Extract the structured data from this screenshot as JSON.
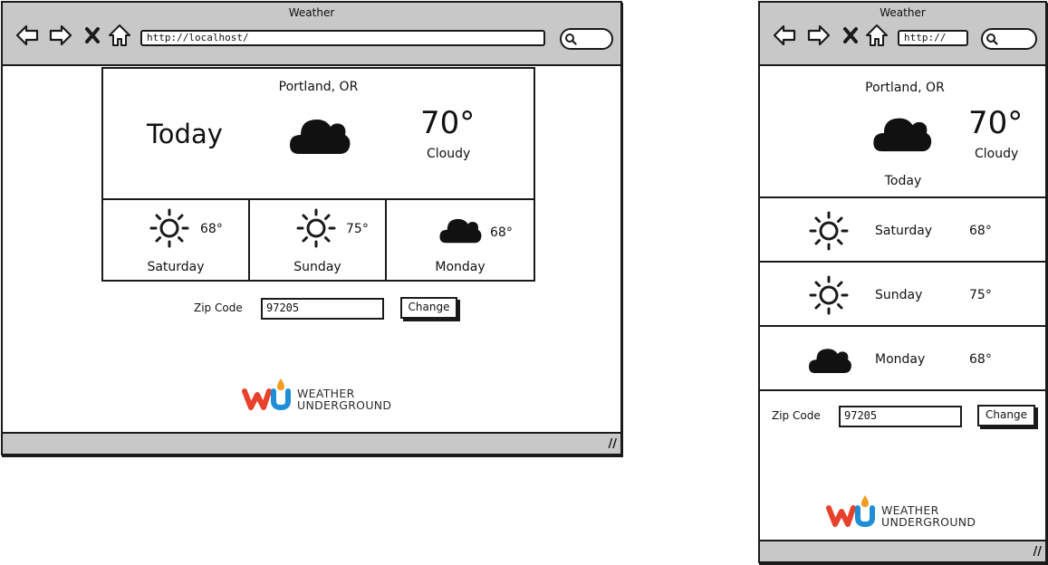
{
  "desktop": {
    "window_title": "Weather",
    "url": "http://localhost/",
    "city": "Portland, OR",
    "today": {
      "label": "Today",
      "temp": "70°",
      "condition": "Cloudy",
      "icon": "cloud-icon"
    },
    "forecast": [
      {
        "day": "Saturday",
        "temp": "68°",
        "icon": "sun-icon"
      },
      {
        "day": "Sunday",
        "temp": "75°",
        "icon": "sun-icon"
      },
      {
        "day": "Monday",
        "temp": "68°",
        "icon": "cloud-icon"
      }
    ],
    "zip_label": "Zip Code",
    "zip_value": "97205",
    "change_label": "Change",
    "logo": {
      "line1": "WEATHER",
      "line2": "UNDERGROUND"
    }
  },
  "mobile": {
    "window_title": "Weather",
    "url": "http://",
    "city": "Portland, OR",
    "today": {
      "label": "Today",
      "temp": "70°",
      "condition": "Cloudy",
      "icon": "cloud-icon"
    },
    "forecast": [
      {
        "day": "Saturday",
        "temp": "68°",
        "icon": "sun-icon"
      },
      {
        "day": "Sunday",
        "temp": "75°",
        "icon": "sun-icon"
      },
      {
        "day": "Monday",
        "temp": "68°",
        "icon": "cloud-icon"
      }
    ],
    "zip_label": "Zip Code",
    "zip_value": "97205",
    "change_label": "Change",
    "logo": {
      "line1": "WEATHER",
      "line2": "UNDERGROUND"
    }
  },
  "colors": {
    "chrome": "#c8c8c8",
    "ink": "#1a1a1a",
    "logo_red": "#e8412c",
    "logo_orange": "#f39c1e",
    "logo_blue": "#1e8fd6"
  }
}
